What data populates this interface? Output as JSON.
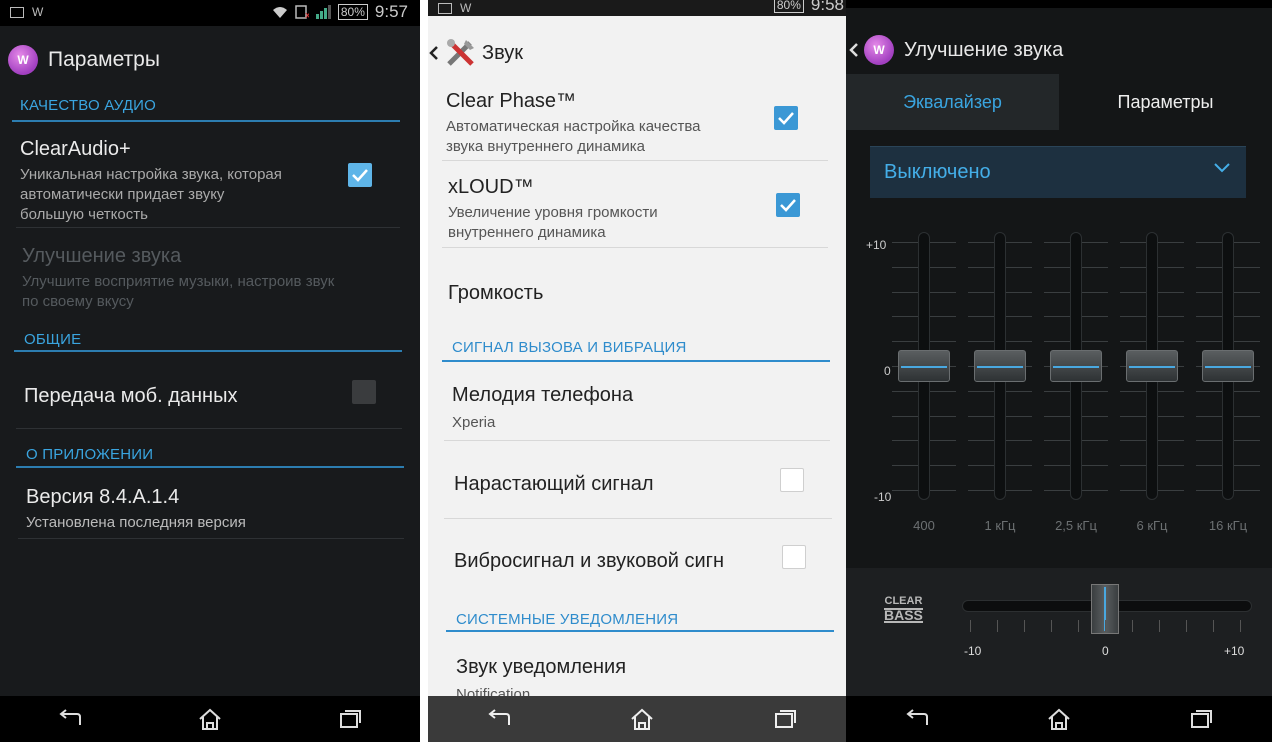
{
  "statusbar": {
    "screen1_battery": "80%",
    "screen1_time": "9:57",
    "screen2_battery": "80%",
    "screen2_time": "9:58"
  },
  "screen1": {
    "title": "Параметры",
    "sections": {
      "audio_quality": "КАЧЕСТВО АУДИО",
      "general": "ОБЩИЕ",
      "about": "О ПРИЛОЖЕНИИ"
    },
    "clearaudio": {
      "title": "ClearAudio+",
      "subtitle_1": "Уникальная настройка звука, которая",
      "subtitle_2": "автоматически придает звуку",
      "subtitle_3": "большую четкость",
      "checked": true
    },
    "sound_enhance": {
      "title": "Улучшение звука",
      "subtitle_1": "Улучшите восприятие музыки, настроив звук",
      "subtitle_2": "по своему вкусу"
    },
    "mobile_data": {
      "title": "Передача моб. данных",
      "checked": false
    },
    "version": {
      "title": "Версия 8.4.A.1.4",
      "subtitle": "Установлена последняя версия"
    }
  },
  "screen2": {
    "title": "Звук",
    "clear_phase": {
      "title": "Clear Phase™",
      "subtitle_1": "Автоматическая настройка качества",
      "subtitle_2": "звука внутреннего динамика",
      "checked": true
    },
    "xloud": {
      "title": "xLOUD™",
      "subtitle_1": "Увеличение уровня громкости",
      "subtitle_2": "внутреннего динамика",
      "checked": true
    },
    "volume": "Громкость",
    "section_ring": "СИГНАЛ ВЫЗОВА И ВИБРАЦИЯ",
    "ringtone": {
      "title": "Мелодия телефона",
      "subtitle": "Xperia"
    },
    "ascending": {
      "title": "Нарастающий сигнал",
      "checked": false
    },
    "vibrate": {
      "title": "Вибросигнал и звуковой сигн",
      "checked": false
    },
    "section_notify": "СИСТЕМНЫЕ УВЕДОМЛЕНИЯ",
    "notification": {
      "title": "Звук уведомления",
      "subtitle": "Notification"
    }
  },
  "screen3": {
    "title": "Улучшение звука",
    "tabs": [
      "Эквалайзер",
      "Параметры"
    ],
    "preset": "Выключено",
    "eq_labels": {
      "top": "+10",
      "mid": "0",
      "bottom": "-10"
    },
    "bands": [
      {
        "label": "400",
        "value": 0
      },
      {
        "label": "1 кГц",
        "value": 0
      },
      {
        "label": "2,5 кГц",
        "value": 0
      },
      {
        "label": "6 кГц",
        "value": 0
      },
      {
        "label": "16 кГц",
        "value": 0
      }
    ],
    "clear_bass": {
      "logo_top": "CLEAR",
      "logo_bottom": "BASS",
      "min": "-10",
      "mid": "0",
      "max": "+10",
      "value": 0
    }
  },
  "icons": {
    "back": "back-arrow-icon",
    "home": "home-icon",
    "recent": "recent-apps-icon",
    "walkman": "walkman-icon",
    "tools": "tools-icon"
  },
  "colors": {
    "accent": "#3aa5e0",
    "checkbox_on": "#5fb5e8"
  }
}
